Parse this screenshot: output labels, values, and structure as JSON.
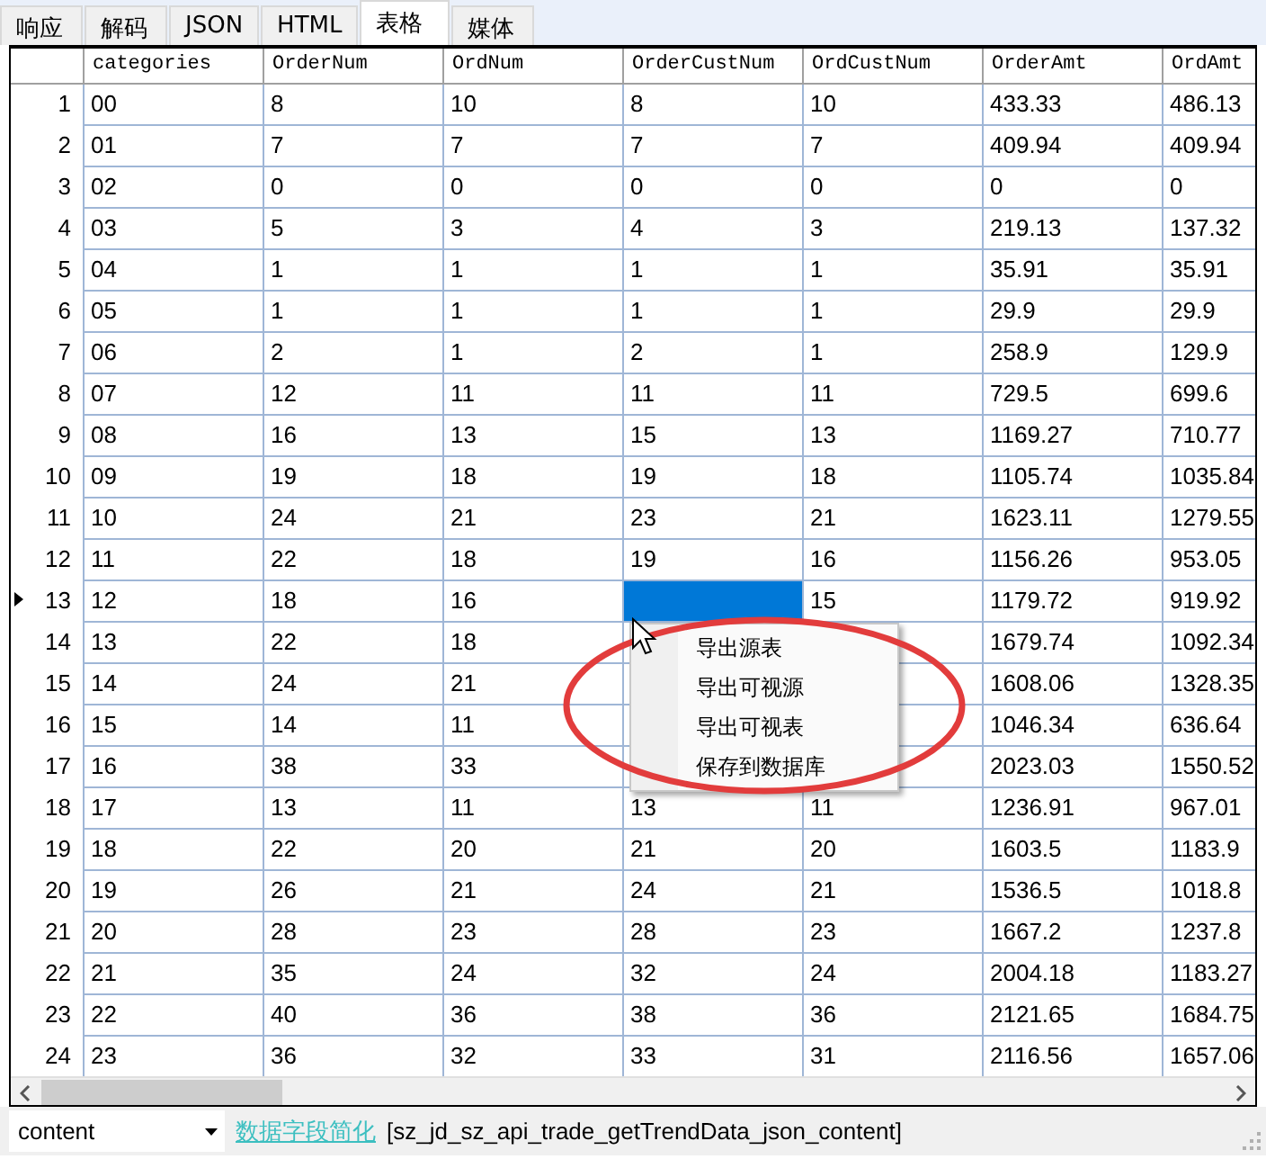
{
  "tabs": [
    {
      "label": "响应",
      "selected": false
    },
    {
      "label": "解码",
      "selected": false
    },
    {
      "label": "JSON",
      "selected": false
    },
    {
      "label": "HTML",
      "selected": false
    },
    {
      "label": "表格",
      "selected": true
    },
    {
      "label": "媒体",
      "selected": false
    }
  ],
  "table": {
    "columns": [
      "categories",
      "OrderNum",
      "OrdNum",
      "OrderCustNum",
      "OrdCustNum",
      "OrderAmt",
      "OrdAmt"
    ],
    "rows": [
      {
        "number": "1",
        "selected": false,
        "cells": [
          "00",
          "8",
          "10",
          "8",
          "10",
          "433.33",
          "486.13"
        ]
      },
      {
        "number": "2",
        "selected": false,
        "cells": [
          "01",
          "7",
          "7",
          "7",
          "7",
          "409.94",
          "409.94"
        ]
      },
      {
        "number": "3",
        "selected": false,
        "cells": [
          "02",
          "0",
          "0",
          "0",
          "0",
          "0",
          "0"
        ]
      },
      {
        "number": "4",
        "selected": false,
        "cells": [
          "03",
          "5",
          "3",
          "4",
          "3",
          "219.13",
          "137.32"
        ]
      },
      {
        "number": "5",
        "selected": false,
        "cells": [
          "04",
          "1",
          "1",
          "1",
          "1",
          "35.91",
          "35.91"
        ]
      },
      {
        "number": "6",
        "selected": false,
        "cells": [
          "05",
          "1",
          "1",
          "1",
          "1",
          "29.9",
          "29.9"
        ]
      },
      {
        "number": "7",
        "selected": false,
        "cells": [
          "06",
          "2",
          "1",
          "2",
          "1",
          "258.9",
          "129.9"
        ]
      },
      {
        "number": "8",
        "selected": false,
        "cells": [
          "07",
          "12",
          "11",
          "11",
          "11",
          "729.5",
          "699.6"
        ]
      },
      {
        "number": "9",
        "selected": false,
        "cells": [
          "08",
          "16",
          "13",
          "15",
          "13",
          "1169.27",
          "710.77"
        ]
      },
      {
        "number": "10",
        "selected": false,
        "cells": [
          "09",
          "19",
          "18",
          "19",
          "18",
          "1105.74",
          "1035.84"
        ]
      },
      {
        "number": "11",
        "selected": false,
        "cells": [
          "10",
          "24",
          "21",
          "23",
          "21",
          "1623.11",
          "1279.55"
        ]
      },
      {
        "number": "12",
        "selected": false,
        "cells": [
          "11",
          "22",
          "18",
          "19",
          "16",
          "1156.26",
          "953.05"
        ]
      },
      {
        "number": "13",
        "selected": true,
        "cells": [
          "12",
          "18",
          "16",
          {
            "selected": true
          },
          "15",
          "1179.72",
          "919.92"
        ]
      },
      {
        "number": "14",
        "selected": false,
        "cells": [
          "13",
          "22",
          "18",
          null,
          null,
          "1679.74",
          "1092.34"
        ]
      },
      {
        "number": "15",
        "selected": false,
        "cells": [
          "14",
          "24",
          "21",
          null,
          null,
          "1608.06",
          "1328.35"
        ]
      },
      {
        "number": "16",
        "selected": false,
        "cells": [
          "15",
          "14",
          "11",
          null,
          null,
          "1046.34",
          "636.64"
        ]
      },
      {
        "number": "17",
        "selected": false,
        "cells": [
          "16",
          "38",
          "33",
          null,
          null,
          "2023.03",
          "1550.52"
        ]
      },
      {
        "number": "18",
        "selected": false,
        "cells": [
          "17",
          "13",
          "11",
          "13",
          "11",
          "1236.91",
          "967.01"
        ]
      },
      {
        "number": "19",
        "selected": false,
        "cells": [
          "18",
          "22",
          "20",
          "21",
          "20",
          "1603.5",
          "1183.9"
        ]
      },
      {
        "number": "20",
        "selected": false,
        "cells": [
          "19",
          "26",
          "21",
          "24",
          "21",
          "1536.5",
          "1018.8"
        ]
      },
      {
        "number": "21",
        "selected": false,
        "cells": [
          "20",
          "28",
          "23",
          "28",
          "23",
          "1667.2",
          "1237.8"
        ]
      },
      {
        "number": "22",
        "selected": false,
        "cells": [
          "21",
          "35",
          "24",
          "32",
          "24",
          "2004.18",
          "1183.27"
        ]
      },
      {
        "number": "23",
        "selected": false,
        "cells": [
          "22",
          "40",
          "36",
          "38",
          "36",
          "2121.65",
          "1684.75"
        ]
      },
      {
        "number": "24",
        "selected": false,
        "cells": [
          "23",
          "36",
          "32",
          "33",
          "31",
          "2116.56",
          "1657.06"
        ]
      }
    ]
  },
  "context_menu": {
    "items": [
      "导出源表",
      "导出可视源",
      "导出可视表",
      "保存到数据库"
    ]
  },
  "status_bar": {
    "field": "content",
    "link": "数据字段简化",
    "source": "[sz_jd_sz_api_trade_getTrendData_json_content]"
  }
}
